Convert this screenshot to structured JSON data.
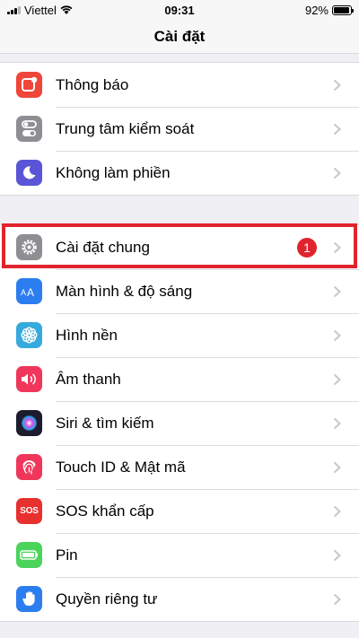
{
  "status_bar": {
    "carrier": "Viettel",
    "time": "09:31",
    "battery_percent": "92%",
    "battery_level": 0.92
  },
  "nav": {
    "title": "Cài đặt"
  },
  "groups": [
    {
      "items": [
        {
          "label": "Thông báo",
          "icon": "notifications-icon",
          "color": "#f0453a"
        },
        {
          "label": "Trung tâm kiểm soát",
          "icon": "control-center-icon",
          "color": "#8e8e93"
        },
        {
          "label": "Không làm phiền",
          "icon": "moon-icon",
          "color": "#5a55d6"
        }
      ]
    },
    {
      "items": [
        {
          "label": "Cài đặt chung",
          "icon": "gear-icon",
          "color": "#8e8e93",
          "badge": "1",
          "highlighted": true
        },
        {
          "label": "Màn hình & độ sáng",
          "icon": "display-brightness-icon",
          "color": "#2c7ef0"
        },
        {
          "label": "Hình nền",
          "icon": "wallpaper-flower-icon",
          "color": "#36aadc"
        },
        {
          "label": "Âm thanh",
          "icon": "speaker-icon",
          "color": "#f0365a"
        },
        {
          "label": "Siri & tìm kiếm",
          "icon": "siri-icon",
          "color": "#1c1c2e"
        },
        {
          "label": "Touch ID & Mật mã",
          "icon": "fingerprint-icon",
          "color": "#f0365a"
        },
        {
          "label": "SOS khẩn cấp",
          "icon": "sos-icon",
          "color": "#e8302e",
          "icon_text": "SOS"
        },
        {
          "label": "Pin",
          "icon": "battery-icon",
          "color": "#4cd35c"
        },
        {
          "label": "Quyền riêng tư",
          "icon": "hand-icon",
          "color": "#2c7ef0"
        }
      ]
    }
  ],
  "colors": {
    "highlight_border": "#e1232d",
    "badge": "#e0242e",
    "chevron": "#c7c7cc"
  }
}
